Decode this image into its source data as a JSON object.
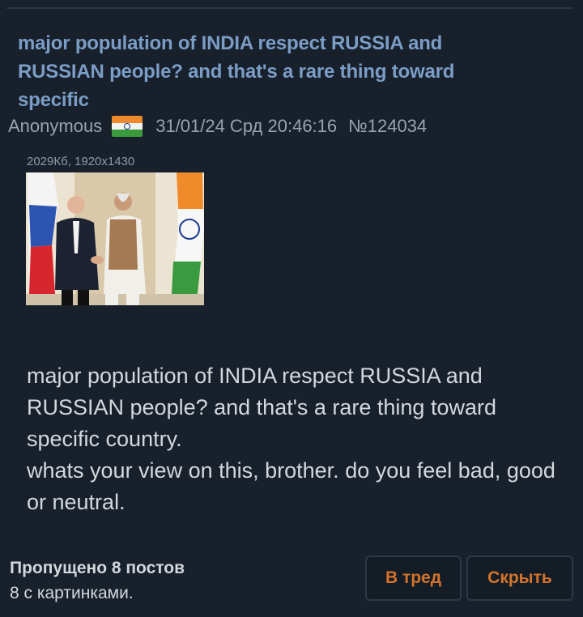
{
  "post": {
    "subject": "major population of INDIA respect RUSSIA and RUSSIAN people? and that's a rare thing toward specific",
    "author": "Anonymous",
    "country_flag": "india-flag",
    "date": "31/01/24 Срд 20:46:16",
    "number": "№124034",
    "file": {
      "info": "2029Кб, 1920x1430"
    },
    "body_lines": [
      "major population of INDIA respect RUSSIA and RUSSIAN people? and that's a rare thing toward specific country.",
      "whats your view on this, brother. do you feel bad, good or neutral."
    ]
  },
  "thread_footer": {
    "skipped": "Пропущено 8 постов",
    "with_images": "8 с картинками.",
    "to_thread_label": "В тред",
    "hide_label": "Скрыть"
  },
  "colors": {
    "background": "#17202b",
    "subject": "#7c9dc6",
    "meta": "#9aa3ad",
    "text": "#d4d8dd",
    "button_text": "#d4742b"
  }
}
